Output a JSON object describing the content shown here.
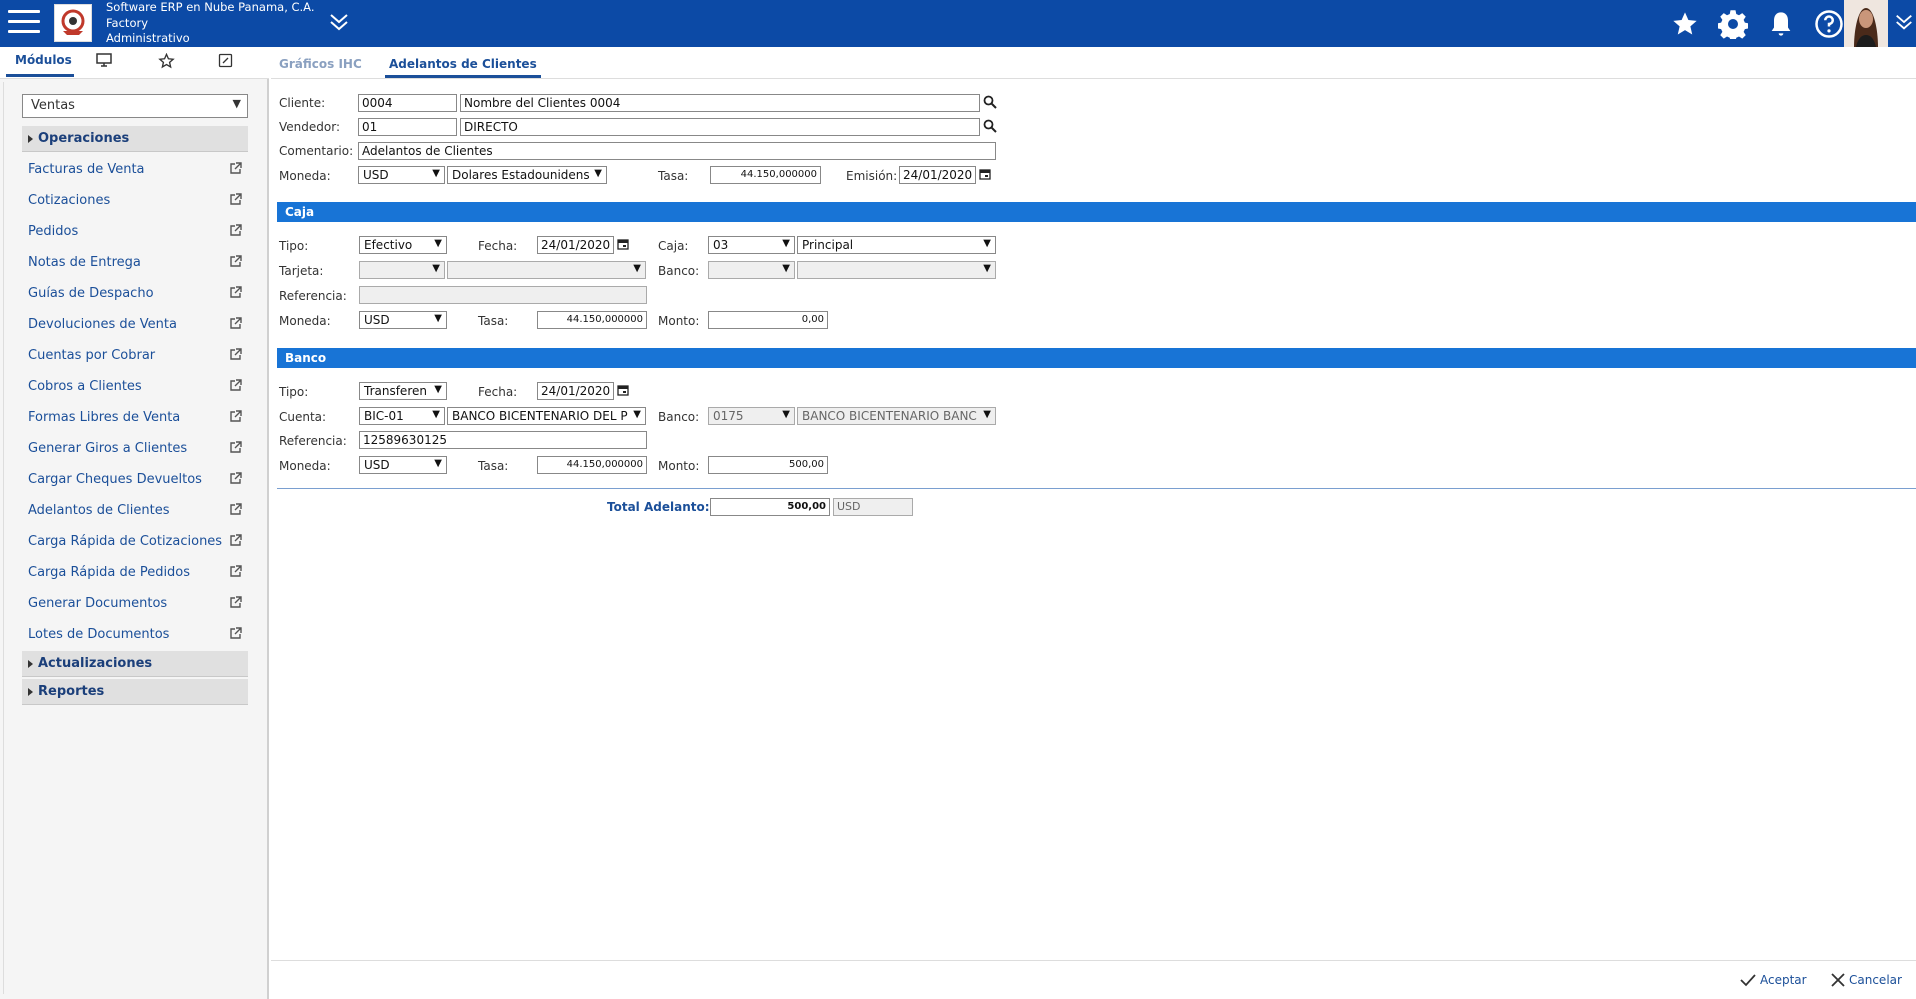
{
  "header": {
    "company_line1": "Software ERP en Nube Panama, C.A.",
    "company_line2": "Factory",
    "company_line3": "Administrativo",
    "icons": [
      "menu-icon",
      "star-icon",
      "gear-icon",
      "bell-icon",
      "help-icon",
      "chevron-down-icon"
    ]
  },
  "sidebar": {
    "tabs": [
      {
        "label": "Módulos",
        "icon": ""
      },
      {
        "label": "",
        "icon": "monitor-icon"
      },
      {
        "label": "",
        "icon": "star-icon"
      },
      {
        "label": "",
        "icon": "edit-note-icon"
      }
    ],
    "module_selected": "Ventas",
    "groups": {
      "operaciones": "Operaciones",
      "actualizaciones": "Actualizaciones",
      "reportes": "Reportes"
    },
    "items": [
      {
        "label": "Facturas de Venta"
      },
      {
        "label": "Cotizaciones"
      },
      {
        "label": "Pedidos"
      },
      {
        "label": "Notas de Entrega"
      },
      {
        "label": "Guías de Despacho"
      },
      {
        "label": "Devoluciones de Venta"
      },
      {
        "label": "Cuentas por Cobrar"
      },
      {
        "label": "Cobros a Clientes"
      },
      {
        "label": "Formas Libres de Venta"
      },
      {
        "label": "Generar Giros a Clientes"
      },
      {
        "label": "Cargar Cheques Devueltos"
      },
      {
        "label": "Adelantos de Clientes"
      },
      {
        "label": "Carga Rápida de Cotizaciones"
      },
      {
        "label": "Carga Rápida de Pedidos"
      },
      {
        "label": "Generar Documentos"
      },
      {
        "label": "Lotes de Documentos"
      }
    ]
  },
  "main": {
    "tabs": [
      {
        "label": "Gráficos IHC"
      },
      {
        "label": "Adelantos de Clientes"
      }
    ],
    "header_form": {
      "cliente_label": "Cliente:",
      "cliente_code": "0004",
      "cliente_name": "Nombre del Clientes 0004",
      "vendedor_label": "Vendedor:",
      "vendedor_code": "01",
      "vendedor_name": "DIRECTO",
      "comentario_label": "Comentario:",
      "comentario": "Adelantos de Clientes",
      "moneda_label": "Moneda:",
      "moneda": "USD",
      "moneda_name": "Dolares Estadounidens",
      "tasa_label": "Tasa:",
      "tasa": "44.150,000000",
      "emision_label": "Emisión:",
      "emision": "24/01/2020"
    },
    "caja": {
      "title": "Caja",
      "tipo_label": "Tipo:",
      "tipo": "Efectivo",
      "fecha_label": "Fecha:",
      "fecha": "24/01/2020",
      "caja_label": "Caja:",
      "caja_code": "03",
      "caja_name": "Principal",
      "tarjeta_label": "Tarjeta:",
      "tarjeta": "",
      "tarjeta_name": "",
      "banco_label": "Banco:",
      "banco": "",
      "banco_name": "",
      "referencia_label": "Referencia:",
      "referencia": "",
      "moneda_label": "Moneda:",
      "moneda": "USD",
      "tasa_label": "Tasa:",
      "tasa": "44.150,000000",
      "monto_label": "Monto:",
      "monto": "0,00"
    },
    "banco": {
      "title": "Banco",
      "tipo_label": "Tipo:",
      "tipo": "Transferen",
      "fecha_label": "Fecha:",
      "fecha": "24/01/2020",
      "cuenta_label": "Cuenta:",
      "cuenta_code": "BIC-01",
      "cuenta_name": "BANCO BICENTENARIO DEL P",
      "banco_label": "Banco:",
      "banco_code": "0175",
      "banco_name": "BANCO BICENTENARIO BANC",
      "referencia_label": "Referencia:",
      "referencia": "12589630125",
      "moneda_label": "Moneda:",
      "moneda": "USD",
      "tasa_label": "Tasa:",
      "tasa": "44.150,000000",
      "monto_label": "Monto:",
      "monto": "500,00"
    },
    "total": {
      "label": "Total Adelanto:",
      "value": "500,00",
      "currency": "USD"
    },
    "footer": {
      "accept": "Aceptar",
      "cancel": "Cancelar"
    }
  },
  "colors": {
    "topbar": "#0c4aa6",
    "section": "#1874d6",
    "link": "#1b4f99"
  }
}
